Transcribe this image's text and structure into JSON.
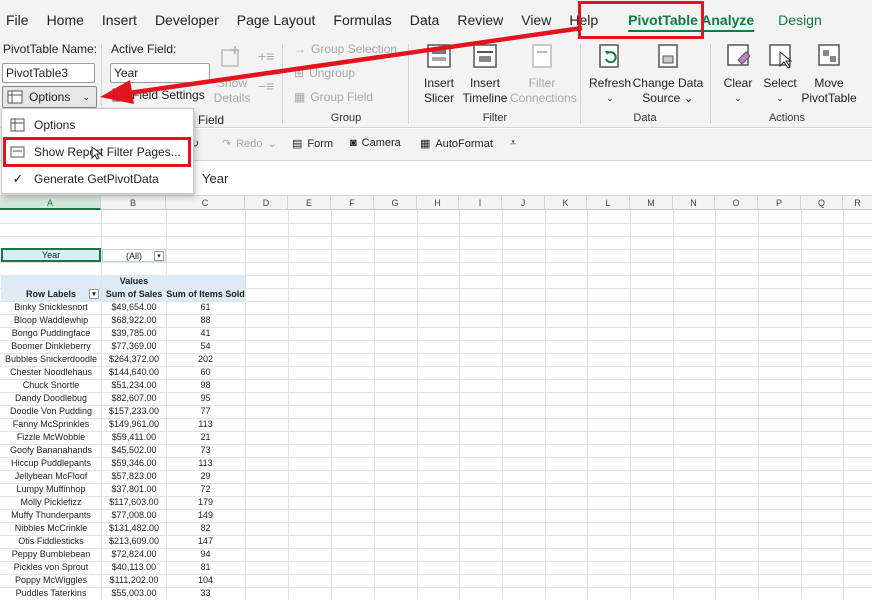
{
  "menu": {
    "tabs": [
      "File",
      "Home",
      "Insert",
      "Developer",
      "Page Layout",
      "Formulas",
      "Data",
      "Review",
      "View",
      "Help",
      "PivotTable Analyze",
      "Design"
    ]
  },
  "ribbon": {
    "pivot_name_label": "PivotTable Name:",
    "pivot_name_value": "PivotTable3",
    "options_label": "Options",
    "active_field_label": "Active Field:",
    "active_field_value": "Year",
    "field_settings_label": "Field Settings",
    "show_details": [
      "Show",
      "Details"
    ],
    "group_selection": "Group Selection",
    "ungroup": "Ungroup",
    "group_field": "Group Field",
    "group_label": "Group",
    "insert_slicer": [
      "Insert",
      "Slicer"
    ],
    "insert_timeline": [
      "Insert",
      "Timeline"
    ],
    "filter_connections": [
      "Filter",
      "Connections"
    ],
    "filter_label": "Filter",
    "refresh": "Refresh",
    "change_data_source": [
      "Change Data",
      "Source"
    ],
    "data_label": "Data",
    "clear": "Clear",
    "select": "Select",
    "move_pivottable": [
      "Move",
      "PivotTable"
    ],
    "actions_label": "Actions",
    "field_group_label": "Field"
  },
  "qat": {
    "redo": "Redo",
    "form": "Form",
    "camera": "Camera",
    "autoformat": "AutoFormat"
  },
  "formula_bar": {
    "text": "Year"
  },
  "dropdown": {
    "items": [
      "Options",
      "Show Report Filter Pages...",
      "Generate GetPivotData"
    ]
  },
  "columns": [
    "A",
    "B",
    "C",
    "D",
    "E",
    "F",
    "G",
    "H",
    "I",
    "J",
    "K",
    "L",
    "M",
    "N",
    "O",
    "P",
    "Q",
    "R"
  ],
  "pivot": {
    "filter_field": "Year",
    "filter_value": "(All)",
    "values_header": "Values",
    "row_labels": "Row Labels",
    "sum_of_sales": "Sum of Sales",
    "sum_of_items": "Sum of Items Sold",
    "rows": [
      [
        "Binky Snicklesnort",
        "$49,654.00",
        "61"
      ],
      [
        "Bloop Waddlewhip",
        "$68,922.00",
        "88"
      ],
      [
        "Bongo Puddingface",
        "$39,785.00",
        "41"
      ],
      [
        "Boomer Dinkleberry",
        "$77,369.00",
        "54"
      ],
      [
        "Bubbles Snickerdoodle",
        "$264,372.00",
        "202"
      ],
      [
        "Chester Noodlehaus",
        "$144,640.00",
        "60"
      ],
      [
        "Chuck Snortle",
        "$51,234.00",
        "98"
      ],
      [
        "Dandy Doodlebug",
        "$82,607.00",
        "95"
      ],
      [
        "Doodle Von Pudding",
        "$157,233.00",
        "77"
      ],
      [
        "Fanny McSprinkles",
        "$149,961.00",
        "113"
      ],
      [
        "Fizzle McWobble",
        "$59,411.00",
        "21"
      ],
      [
        "Goofy Bananahands",
        "$45,502.00",
        "73"
      ],
      [
        "Hiccup Puddlepants",
        "$59,346.00",
        "113"
      ],
      [
        "Jellybean McFloof",
        "$57,823.00",
        "29"
      ],
      [
        "Lumpy Muffinhop",
        "$37,801.00",
        "72"
      ],
      [
        "Molly Picklefizz",
        "$117,603.00",
        "179"
      ],
      [
        "Muffy Thunderpants",
        "$77,008.00",
        "149"
      ],
      [
        "Nibbles McCrinkle",
        "$131,482.00",
        "82"
      ],
      [
        "Otis Fiddlesticks",
        "$213,609.00",
        "147"
      ],
      [
        "Peppy Bumblebean",
        "$72,824.00",
        "94"
      ],
      [
        "Pickles von Sprout",
        "$40,113.00",
        "81"
      ],
      [
        "Poppy McWiggles",
        "$111,202.00",
        "104"
      ],
      [
        "Puddles Taterkins",
        "$55,003.00",
        "33"
      ]
    ]
  },
  "colors": {
    "accent": "#107c41",
    "highlight": "#e3141d",
    "header_blue": "#ddebf7"
  }
}
